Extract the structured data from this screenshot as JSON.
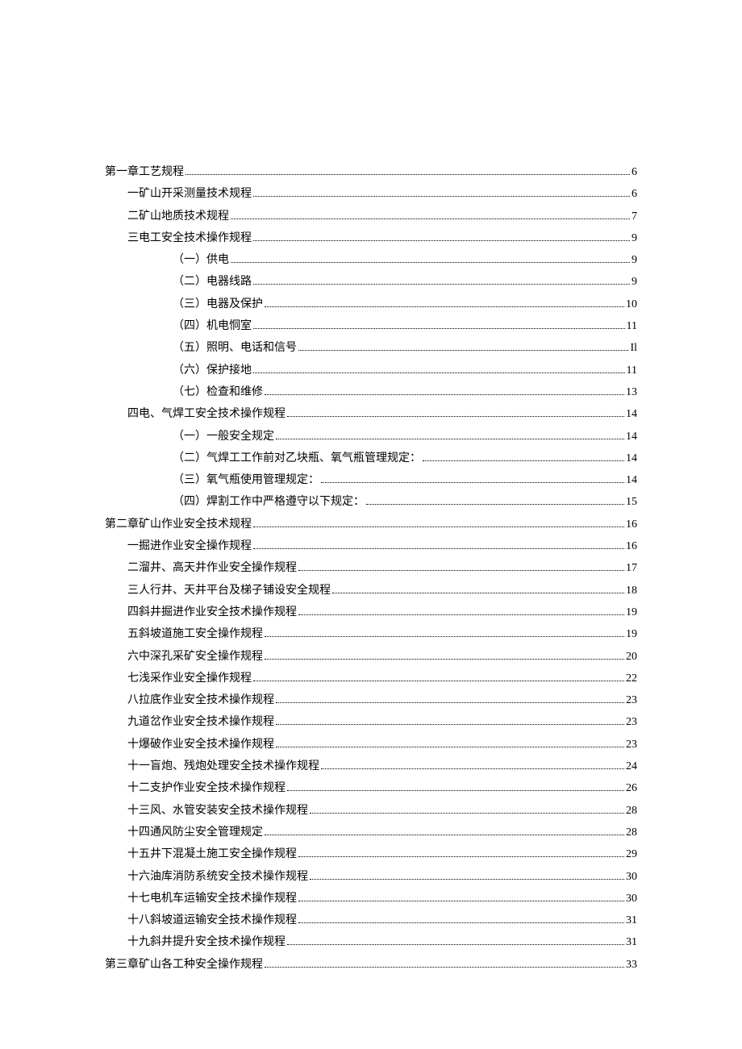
{
  "toc": [
    {
      "label": "第一章工艺规程",
      "page": "6",
      "indent": 0
    },
    {
      "label": "一矿山开采测量技术规程",
      "page": "6",
      "indent": 1
    },
    {
      "label": "二矿山地质技术规程",
      "page": "7",
      "indent": 1
    },
    {
      "label": "三电工安全技术操作规程",
      "page": "9",
      "indent": 1
    },
    {
      "label": "（一）供电",
      "page": "9",
      "indent": 2
    },
    {
      "label": "（二）电器线路",
      "page": "9",
      "indent": 2
    },
    {
      "label": "（三）电器及保护",
      "page": "10",
      "indent": 2
    },
    {
      "label": "（四）机电恫室",
      "page": "11",
      "indent": 2
    },
    {
      "label": "（五）照明、电话和信号",
      "page": "Il",
      "indent": 2
    },
    {
      "label": "（六）保护接地",
      "page": "11",
      "indent": 2
    },
    {
      "label": "（七）检查和维修",
      "page": "13",
      "indent": 2
    },
    {
      "label": "四电、气焊工安全技术操作规程",
      "page": "14",
      "indent": 1
    },
    {
      "label": "（一）一般安全规定",
      "page": "14",
      "indent": 2
    },
    {
      "label": "（二）气焊工工作前对乙块瓶、氧气瓶管理规定：",
      "page": "14",
      "indent": 2
    },
    {
      "label": "（三）氧气瓶使用管理规定：",
      "page": "14",
      "indent": 2
    },
    {
      "label": "（四）焊割工作中严格遵守以下规定：",
      "page": "15",
      "indent": 2
    },
    {
      "label": "第二章矿山作业安全技术规程",
      "page": "16",
      "indent": 0
    },
    {
      "label": "一掘进作业安全操作规程",
      "page": "16",
      "indent": 1
    },
    {
      "label": "二溜井、高天井作业安全操作规程",
      "page": "17",
      "indent": 1
    },
    {
      "label": "三人行井、天井平台及梯子铺设安全规程",
      "page": "18",
      "indent": 1
    },
    {
      "label": "四斜井掘进作业安全技术操作规程",
      "page": "19",
      "indent": 1
    },
    {
      "label": "五斜坡道施工安全操作规程",
      "page": "19",
      "indent": 1
    },
    {
      "label": "六中深孔采矿安全操作规程",
      "page": "20",
      "indent": 1
    },
    {
      "label": "七浅采作业安全操作规程",
      "page": "22",
      "indent": 1
    },
    {
      "label": "八拉底作业安全技术操作规程",
      "page": "23",
      "indent": 1
    },
    {
      "label": "九道岔作业安全技术操作规程",
      "page": "23",
      "indent": 1
    },
    {
      "label": "十爆破作业安全技术操作规程",
      "page": "23",
      "indent": 1
    },
    {
      "label": "十一盲炮、残炮处理安全技术操作规程",
      "page": "24",
      "indent": 1
    },
    {
      "label": "十二支护作业安全技术操作规程",
      "page": "26",
      "indent": 1
    },
    {
      "label": "十三风、水管安装安全技术操作规程",
      "page": "28",
      "indent": 1
    },
    {
      "label": "十四通风防尘安全管理规定",
      "page": "28",
      "indent": 1
    },
    {
      "label": "十五井下混凝土施工安全操作规程",
      "page": "29",
      "indent": 1
    },
    {
      "label": "十六油库消防系统安全技术操作规程",
      "page": "30",
      "indent": 1
    },
    {
      "label": "十七电机车运输安全技术操作规程",
      "page": "30",
      "indent": 1
    },
    {
      "label": "十八斜坡道运输安全技术操作规程",
      "page": "31",
      "indent": 1
    },
    {
      "label": "十九斜井提升安全技术操作规程",
      "page": "31",
      "indent": 1
    },
    {
      "label": "第三章矿山各工种安全操作规程",
      "page": "33",
      "indent": 0
    }
  ]
}
